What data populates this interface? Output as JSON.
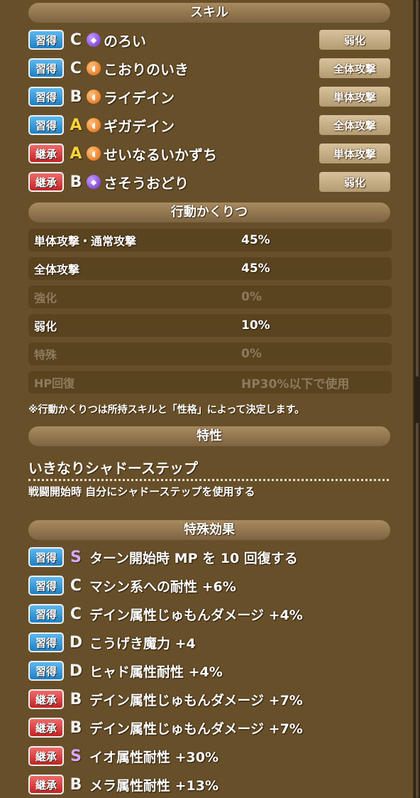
{
  "colors": {
    "panel": "#674f29",
    "learn_badge": "#2f8fd4",
    "inherit_badge": "#d33a3a",
    "rank_A": "#f6d33b",
    "rank_S": "#d9a8ff"
  },
  "skills": {
    "header": "スキル",
    "items": [
      {
        "badge": "習得",
        "badge_type": "learn",
        "rank": "C",
        "orb": "purple",
        "name": "のろい",
        "type": "弱化"
      },
      {
        "badge": "習得",
        "badge_type": "learn",
        "rank": "C",
        "orb": "orange",
        "name": "こおりのいき",
        "type": "全体攻撃"
      },
      {
        "badge": "習得",
        "badge_type": "learn",
        "rank": "B",
        "orb": "orange",
        "name": "ライデイン",
        "type": "単体攻撃"
      },
      {
        "badge": "習得",
        "badge_type": "learn",
        "rank": "A",
        "orb": "orange",
        "name": "ギガデイン",
        "type": "全体攻撃"
      },
      {
        "badge": "継承",
        "badge_type": "inherit",
        "rank": "A",
        "orb": "orange",
        "name": "せいなるいかずち",
        "type": "単体攻撃"
      },
      {
        "badge": "継承",
        "badge_type": "inherit",
        "rank": "B",
        "orb": "purple",
        "name": "さそうおどり",
        "type": "弱化"
      }
    ]
  },
  "action_ratio": {
    "header": "行動かくりつ",
    "rows": [
      {
        "label": "単体攻撃・通常攻撃",
        "value": "45%",
        "dim": false
      },
      {
        "label": "全体攻撃",
        "value": "45%",
        "dim": false
      },
      {
        "label": "強化",
        "value": "0%",
        "dim": true
      },
      {
        "label": "弱化",
        "value": "10%",
        "dim": false
      },
      {
        "label": "特殊",
        "value": "0%",
        "dim": true
      },
      {
        "label": "HP回復",
        "value": "HP30%以下で使用",
        "dim": true
      }
    ],
    "note": "※行動かくりつは所持スキルと「性格」によって決定します。"
  },
  "trait": {
    "header": "特性",
    "name": "いきなりシャドーステップ",
    "description": "戦闘開始時 自分にシャドーステップを使用する"
  },
  "special_effects": {
    "header": "特殊効果",
    "items": [
      {
        "badge": "習得",
        "badge_type": "learn",
        "rank": "S",
        "text": "ターン開始時 MP を 10 回復する"
      },
      {
        "badge": "習得",
        "badge_type": "learn",
        "rank": "C",
        "text": "マシン系への耐性 +6%"
      },
      {
        "badge": "習得",
        "badge_type": "learn",
        "rank": "C",
        "text": "デイン属性じゅもんダメージ +4%"
      },
      {
        "badge": "習得",
        "badge_type": "learn",
        "rank": "D",
        "text": "こうげき魔力 +4"
      },
      {
        "badge": "習得",
        "badge_type": "learn",
        "rank": "D",
        "text": "ヒャド属性耐性 +4%"
      },
      {
        "badge": "継承",
        "badge_type": "inherit",
        "rank": "B",
        "text": "デイン属性じゅもんダメージ +7%"
      },
      {
        "badge": "継承",
        "badge_type": "inherit",
        "rank": "B",
        "text": "デイン属性じゅもんダメージ +7%"
      },
      {
        "badge": "継承",
        "badge_type": "inherit",
        "rank": "S",
        "text": "イオ属性耐性 +30%"
      },
      {
        "badge": "継承",
        "badge_type": "inherit",
        "rank": "B",
        "text": "メラ属性耐性 +13%"
      }
    ]
  }
}
